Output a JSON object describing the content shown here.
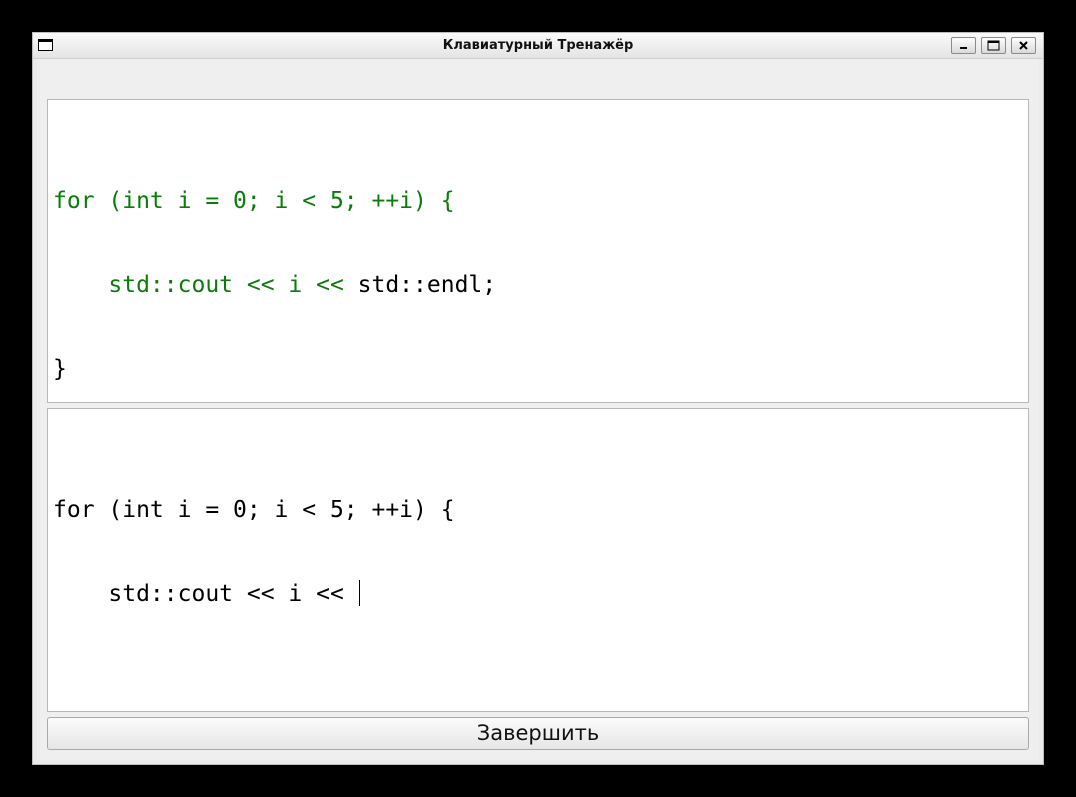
{
  "window": {
    "title": "Клавиатурный Тренажёр"
  },
  "titlebar_buttons": {
    "minimize_icon": "minimize-icon",
    "maximize_icon": "maximize-icon",
    "close_icon": "close-icon"
  },
  "target_text": {
    "lines": [
      {
        "typed": "for (int i = 0; i < 5; ++i) {",
        "rest": ""
      },
      {
        "typed": "    std::cout << i << ",
        "rest": "std::endl;"
      },
      {
        "typed": "",
        "rest": "}"
      }
    ]
  },
  "input_text": {
    "lines": [
      "for (int i = 0; i < 5; ++i) {",
      "    std::cout << i << "
    ]
  },
  "finish_button": {
    "label": "Завершить"
  },
  "colors": {
    "typed": "#0a7c0a",
    "remaining": "#000000"
  }
}
